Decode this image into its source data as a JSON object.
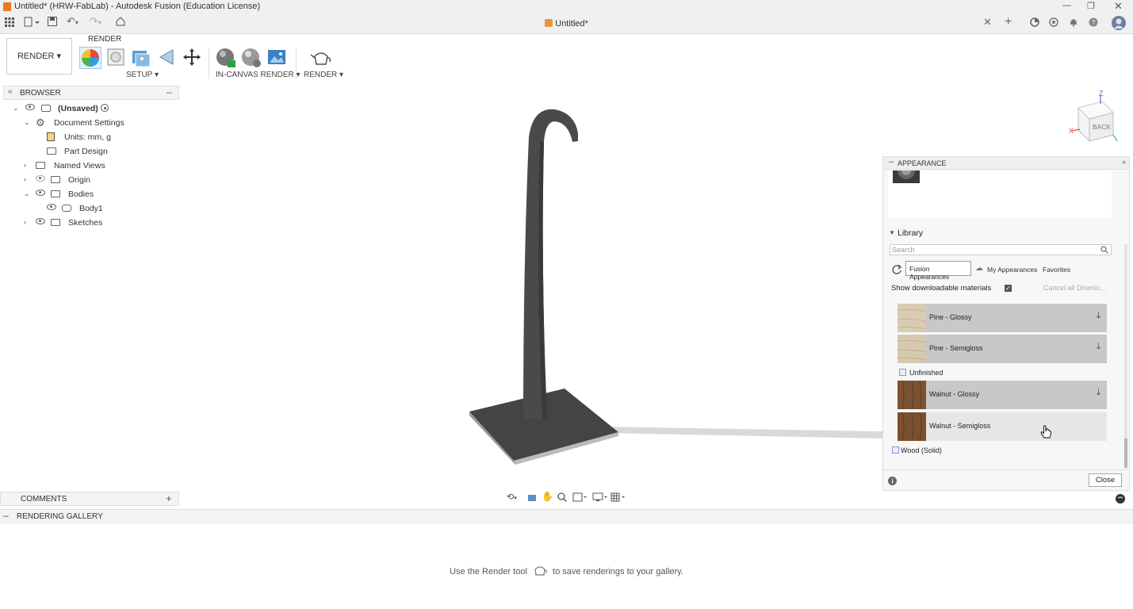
{
  "window": {
    "title": "Untitled* (HRW-FabLab) - Autodesk Fusion (Education License)"
  },
  "tabs": {
    "active_doc": "Untitled*"
  },
  "toolbar": {
    "workspace": "RENDER ▾",
    "section_label": "RENDER",
    "setup_label": "SETUP ▾",
    "incanvas_label": "IN-CANVAS RENDER ▾",
    "render_label": "RENDER ▾"
  },
  "browser": {
    "title": "BROWSER",
    "items": [
      {
        "label": "(Unsaved)"
      },
      {
        "label": "Document Settings"
      },
      {
        "label": "Units: mm, g"
      },
      {
        "label": "Part Design"
      },
      {
        "label": "Named Views"
      },
      {
        "label": "Origin"
      },
      {
        "label": "Bodies"
      },
      {
        "label": "Body1"
      },
      {
        "label": "Sketches"
      }
    ]
  },
  "viewcube": {
    "face": "BACK",
    "axis_z": "Z",
    "axis_x": "X"
  },
  "appearance": {
    "title": "APPEARANCE",
    "library_label": "Library",
    "search_placeholder": "Search",
    "tabs": [
      "Fusion Appearances",
      "My Appearances",
      "Favorites"
    ],
    "show_downloadable": "Show downloadable materials",
    "cancel_downloads": "Cancel all Downlc...",
    "materials": [
      {
        "name": "Pine - Glossy",
        "type": "pine"
      },
      {
        "name": "Pine - Semigloss",
        "type": "pine"
      },
      {
        "name": "Unfinished",
        "type": "folder"
      },
      {
        "name": "Walnut - Glossy",
        "type": "walnut"
      },
      {
        "name": "Walnut - Semigloss",
        "type": "walnut"
      },
      {
        "name": "Wood (Solid)",
        "type": "folder"
      }
    ],
    "close_label": "Close"
  },
  "comments": {
    "title": "COMMENTS"
  },
  "gallery": {
    "title": "RENDERING GALLERY",
    "hint_before": "Use the Render tool",
    "hint_after": "to save renderings to your gallery."
  },
  "colors": {
    "accent": "#0696d7",
    "pine": "#d8ccb4",
    "walnut": "#7a5130",
    "model": "#4a4a4a"
  }
}
